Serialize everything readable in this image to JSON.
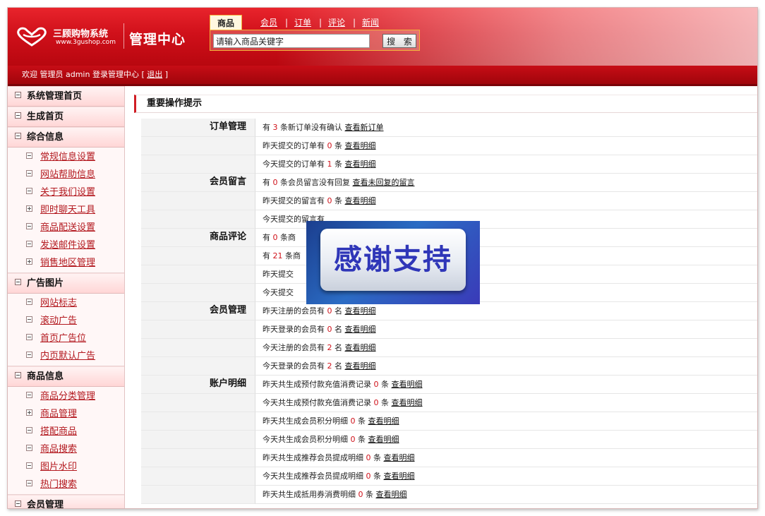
{
  "header": {
    "logo_name": "三顾购物系统",
    "logo_url": "www.3gushop.com",
    "admin_title": "管理中心",
    "search_tabs": [
      "商品",
      "会员",
      "订单",
      "评论",
      "新闻"
    ],
    "search_value": "请输入商品关键字",
    "search_button": "搜 索",
    "welcome_prefix": "欢迎 管理员 admin 登录管理中心 [",
    "logout": "退出",
    "welcome_suffix": "]"
  },
  "sidebar": {
    "s1": "系统管理首页",
    "s2": "生成首页",
    "s3": "综合信息",
    "s3_items": [
      "常规信息设置",
      "网站帮助信息",
      "关于我们设置",
      "即时聊天工具",
      "商品配送设置",
      "发送邮件设置",
      "销售地区管理"
    ],
    "s4": "广告图片",
    "s4_items": [
      "网站标志",
      "滚动广告",
      "首页广告位",
      "内页默认广告"
    ],
    "s5": "商品信息",
    "s5_items": [
      "商品分类管理",
      "商品管理",
      "搭配商品",
      "商品搜索",
      "图片水印",
      "热门搜索"
    ],
    "s6": "会员管理"
  },
  "main": {
    "panel_title": "重要操作提示",
    "rows": [
      {
        "cat": "订单管理",
        "pre": "有",
        "num": "3",
        "post": "条新订单没有确认",
        "link": "查看新订单"
      },
      {
        "cat": "",
        "pre": "昨天提交的订单有",
        "num": "0",
        "post": "条",
        "link": "查看明细"
      },
      {
        "cat": "",
        "pre": "今天提交的订单有",
        "num": "1",
        "post": "条",
        "link": "查看明细"
      },
      {
        "cat": "会员留言",
        "pre": "有",
        "num": "0",
        "post": "条会员留言没有回复",
        "link": "查看未回复的留言"
      },
      {
        "cat": "",
        "pre": "昨天提交的留言有",
        "num": "0",
        "post": "条",
        "link": "查看明细"
      },
      {
        "cat": "",
        "pre": "今天提交的留言有",
        "num": "",
        "post": "",
        "link": ""
      },
      {
        "cat": "商品评论",
        "pre": "有",
        "num": "0",
        "post": "条商",
        "link": ""
      },
      {
        "cat": "",
        "pre": "有",
        "num": "21",
        "post": "条商",
        "link": ""
      },
      {
        "cat": "",
        "pre": "昨天提交",
        "num": "",
        "post": "",
        "link": ""
      },
      {
        "cat": "",
        "pre": "今天提交",
        "num": "",
        "post": "",
        "link": ""
      },
      {
        "cat": "会员管理",
        "pre": "昨天注册的会员有",
        "num": "0",
        "post": "名",
        "link": "查看明细"
      },
      {
        "cat": "",
        "pre": "昨天登录的会员有",
        "num": "0",
        "post": "名",
        "link": "查看明细"
      },
      {
        "cat": "",
        "pre": "今天注册的会员有",
        "num": "2",
        "post": "名",
        "link": "查看明细"
      },
      {
        "cat": "",
        "pre": "今天登录的会员有",
        "num": "2",
        "post": "名",
        "link": "查看明细"
      },
      {
        "cat": "账户明细",
        "pre": "昨天共生成预付款充值消费记录",
        "num": "0",
        "post": "条",
        "link": "查看明细"
      },
      {
        "cat": "",
        "pre": "今天共生成预付款充值消费记录",
        "num": "0",
        "post": "条",
        "link": "查看明细"
      },
      {
        "cat": "",
        "pre": "昨天共生成会员积分明细",
        "num": "0",
        "post": "条",
        "link": "查看明细"
      },
      {
        "cat": "",
        "pre": "今天共生成会员积分明细",
        "num": "0",
        "post": "条",
        "link": "查看明细"
      },
      {
        "cat": "",
        "pre": "昨天共生成推荐会员提成明细",
        "num": "0",
        "post": "条",
        "link": "查看明细"
      },
      {
        "cat": "",
        "pre": "今天共生成推荐会员提成明细",
        "num": "0",
        "post": "条",
        "link": "查看明细"
      },
      {
        "cat": "",
        "pre": "昨天共生成抵用券消费明细",
        "num": "0",
        "post": "条",
        "link": "查看明细"
      }
    ]
  },
  "overlay": {
    "text": "感谢支持"
  },
  "colors": {
    "header_red": "#d0101a",
    "accent": "#d01d24",
    "number": "#d0121a",
    "overlay_blue": "#2b6cc4"
  }
}
